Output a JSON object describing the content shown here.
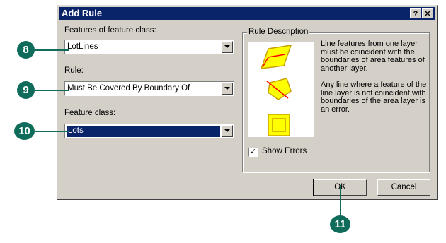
{
  "dialog": {
    "title": "Add Rule",
    "help_glyph": "?",
    "close_glyph": "✕"
  },
  "features_field": {
    "label": "Features of feature class:",
    "value": "LotLines"
  },
  "rule_field": {
    "label": "Rule:",
    "value": "Must Be Covered By Boundary Of"
  },
  "feature_class_field": {
    "label": "Feature class:",
    "value": "Lots"
  },
  "rule_description": {
    "legend": "Rule Description",
    "paragraph1": "Line features from one layer must be coincident with the boundaries of area features of another layer.",
    "paragraph2": "Any line where a feature of the line layer is not coincident with boundaries of the area layer is an error."
  },
  "show_errors": {
    "label": "Show Errors",
    "checked": true,
    "check_glyph": "✓"
  },
  "buttons": {
    "ok": "OK",
    "cancel": "Cancel"
  },
  "callouts": {
    "c8": "8",
    "c9": "9",
    "c10": "10",
    "c11": "11"
  },
  "colors": {
    "titlebar": "#0a246a",
    "callout": "#0f6b5a",
    "shape_fill": "#ffff00",
    "shape_stroke": "#c9a000",
    "error_line": "#ff0000"
  }
}
